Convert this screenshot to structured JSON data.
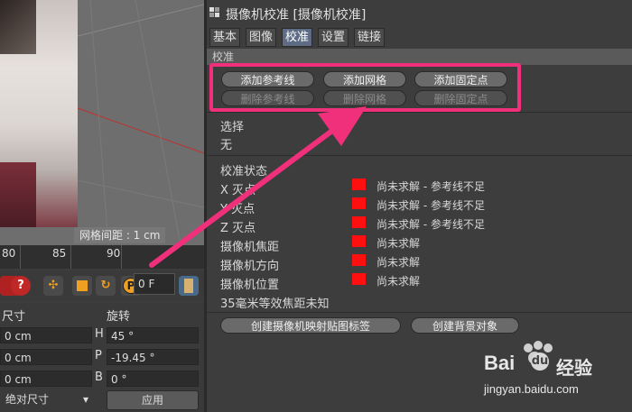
{
  "viewport": {
    "grid_spacing": "网格间距 : 1 cm"
  },
  "timeline": {
    "ticks": [
      "80",
      "85",
      "90"
    ],
    "frame": "0 F"
  },
  "coords": {
    "size_header": "尺寸",
    "rotation_header": "旋转",
    "rows": [
      {
        "value": "0 cm",
        "rot_label": "H",
        "rot_value": "45 °"
      },
      {
        "value": "0 cm",
        "rot_label": "P",
        "rot_value": "-19.45 °"
      },
      {
        "value": "0 cm",
        "rot_label": "B",
        "rot_value": "0 °"
      }
    ],
    "mode": "绝对尺寸",
    "apply": "应用"
  },
  "panel": {
    "title": "摄像机校准 [摄像机校准]",
    "tabs": [
      "基本",
      "图像",
      "校准",
      "设置",
      "链接"
    ],
    "active_tab": "校准",
    "section": "校准",
    "buttons_row1": [
      "添加参考线",
      "添加网格",
      "添加固定点"
    ],
    "buttons_row2": [
      "删除参考线",
      "删除网格",
      "删除固定点"
    ],
    "selection_label": "选择",
    "selection_value": "无",
    "status_header": "校准状态",
    "status": [
      {
        "label": "X 灭点",
        "text": "尚未求解 - 参考线不足"
      },
      {
        "label": "Y 灭点",
        "text": "尚未求解 - 参考线不足"
      },
      {
        "label": "Z 灭点",
        "text": "尚未求解 - 参考线不足"
      },
      {
        "label": "摄像机焦距",
        "text": "尚未求解"
      },
      {
        "label": "摄像机方向",
        "text": "尚未求解"
      },
      {
        "label": "摄像机位置",
        "text": "尚未求解"
      }
    ],
    "focal_note": "35毫米等效焦距未知",
    "bottom_buttons": [
      "创建摄像机映射贴图标签",
      "创建背景对象"
    ],
    "status_color": "#ff1010",
    "highlight_color": "#f0307a"
  },
  "watermark": {
    "brand": "Bai",
    "brand_cn": "经验",
    "url": "jingyan.baidu.com"
  }
}
